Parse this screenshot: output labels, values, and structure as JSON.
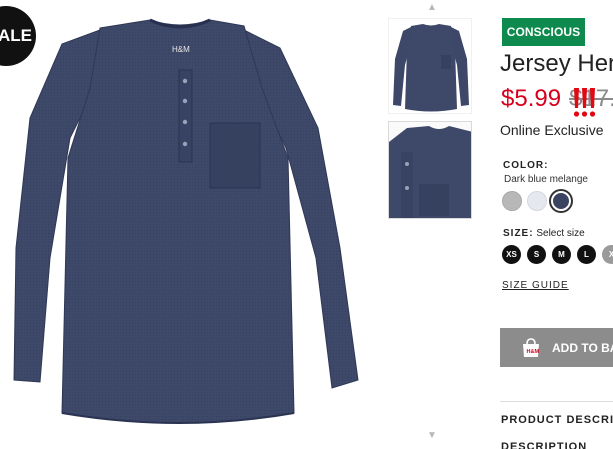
{
  "badges": {
    "sale": "ALE",
    "conscious": "CONSCIOUS"
  },
  "product": {
    "title": "Jersey Hen",
    "price_sale": "$5.99",
    "price_old": "$17.",
    "online_exclusive": "Online Exclusive",
    "colors": {
      "color_label": "COLOR:",
      "selected": "Dark blue melange",
      "swatches": [
        "#b8b8b8",
        "#e6e8ef",
        "#3a4360"
      ]
    },
    "sizes": {
      "size_label": "SIZE:",
      "hint": "Select size",
      "options": [
        "XS",
        "S",
        "M",
        "L",
        "X"
      ]
    },
    "size_guide": "SIZE GUIDE",
    "add_to_bag": "ADD TO BA",
    "description_heading": "PRODUCT DESCRIP",
    "description_sub": "DESCRIPTION"
  },
  "colors": {
    "conscious_green": "#0e8a4f",
    "sale_red": "#d6001c",
    "shirt_navy": "#3b4466"
  },
  "icons": [
    "chevron-up-icon",
    "chevron-down-icon",
    "shopping-bag-icon",
    "exclamation-marks-icon"
  ]
}
